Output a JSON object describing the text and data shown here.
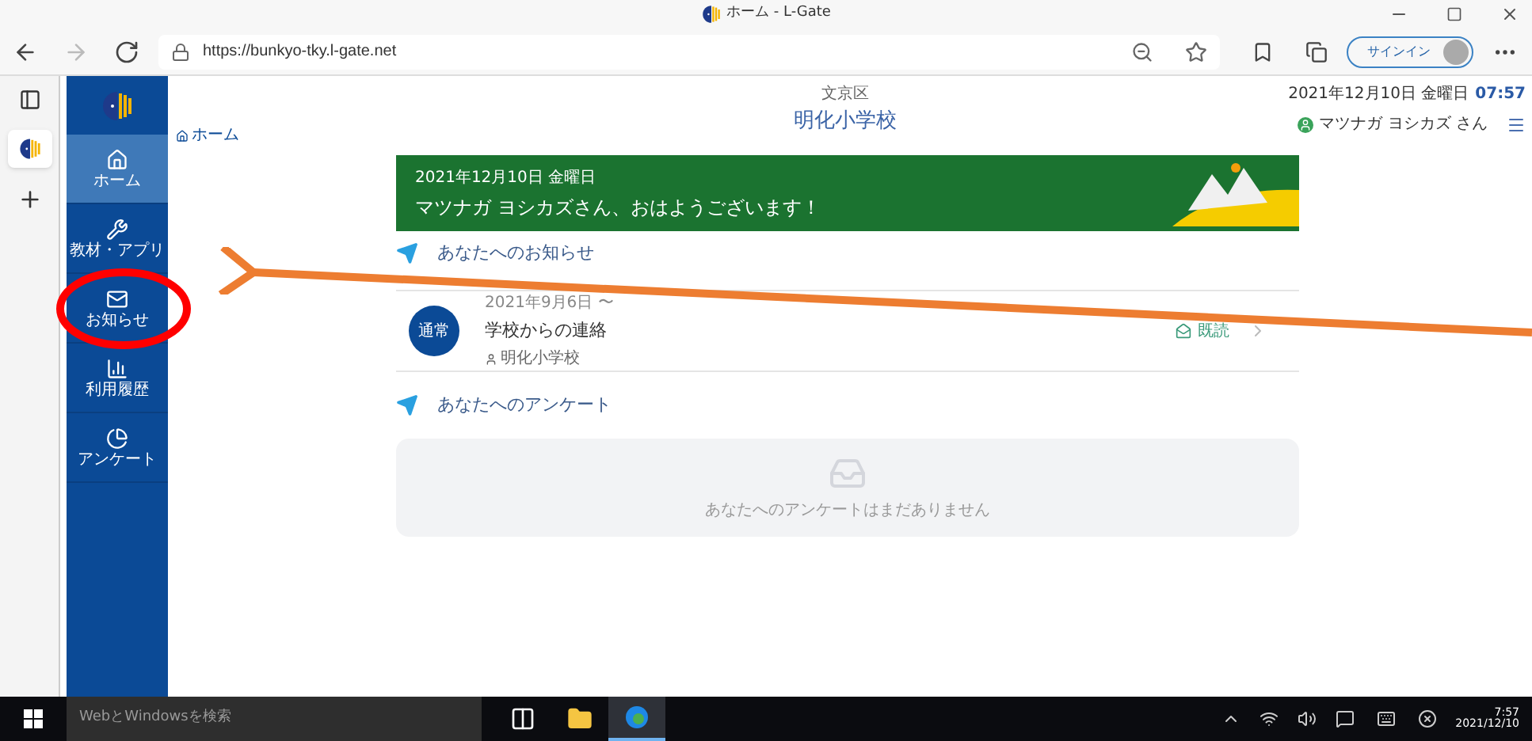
{
  "browser": {
    "tab_title": "ホーム - L-Gate",
    "url": "https://bunkyo-tky.l-gate.net",
    "sign_in": "サインイン"
  },
  "header": {
    "ward": "文京区",
    "school": "明化小学校",
    "date": "2021年12月10日 金曜日",
    "time": "07:57",
    "user": "マツナガ ヨシカズ さん"
  },
  "sidebar": {
    "items": [
      {
        "label": "ホーム",
        "kind": "home",
        "selected": true
      },
      {
        "label": "教材・アプリ",
        "kind": "tools",
        "selected": false
      },
      {
        "label": "お知らせ",
        "kind": "mail",
        "selected": false
      },
      {
        "label": "利用履歴",
        "kind": "chart",
        "selected": false
      },
      {
        "label": "アンケート",
        "kind": "pie",
        "selected": false
      }
    ]
  },
  "breadcrumb": "ホーム",
  "banner": {
    "date": "2021年12月10日 金曜日",
    "greeting": "マツナガ ヨシカズさん、おはようございます！"
  },
  "notices": {
    "title": "あなたへのお知らせ",
    "items": [
      {
        "badge": "通常",
        "period": "2021年9月6日 〜",
        "title": "学校からの連絡",
        "sender": "明化小学校",
        "status": "既読"
      }
    ]
  },
  "surveys": {
    "title": "あなたへのアンケート",
    "empty": "あなたへのアンケートはまだありません"
  },
  "taskbar": {
    "search": "WebとWindowsを検索",
    "apps": [
      {
        "kind": "taskview",
        "selected": false
      },
      {
        "kind": "folder",
        "selected": false
      },
      {
        "kind": "browser",
        "selected": true
      }
    ],
    "time": "7:57",
    "date": "2021/12/10"
  }
}
